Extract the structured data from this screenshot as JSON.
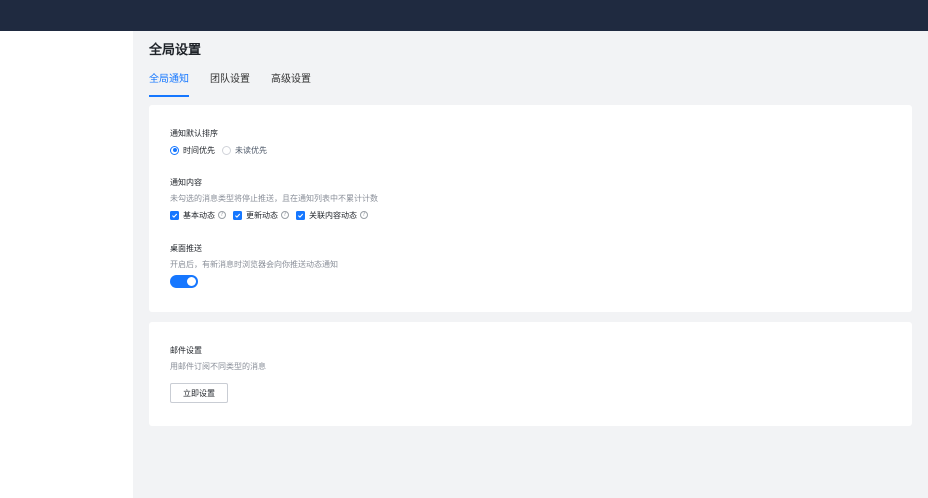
{
  "page": {
    "title": "全局设置"
  },
  "tabs": [
    {
      "label": "全局通知",
      "active": true
    },
    {
      "label": "团队设置",
      "active": false
    },
    {
      "label": "高级设置",
      "active": false
    }
  ],
  "notification_order": {
    "label": "通知默认排序",
    "options": [
      {
        "label": "时间优先",
        "selected": true
      },
      {
        "label": "未读优先",
        "selected": false
      }
    ]
  },
  "notification_content": {
    "label": "通知内容",
    "description": "未勾选的消息类型将停止推送，且在通知列表中不累计计数",
    "options": [
      {
        "label": "基本动态",
        "checked": true,
        "help_icon": "question-circle-icon"
      },
      {
        "label": "更新动态",
        "checked": true,
        "help_icon": "question-circle-icon"
      },
      {
        "label": "关联内容动态",
        "checked": true,
        "help_icon": "question-circle-icon"
      }
    ]
  },
  "desktop_push": {
    "label": "桌面推送",
    "description": "开启后，有新消息时浏览器会向你推送动态通知",
    "enabled": true
  },
  "email": {
    "label": "邮件设置",
    "description": "用邮件订阅不同类型的消息",
    "button_label": "立即设置"
  },
  "colors": {
    "topbar": "#1f2a40",
    "accent": "#1677ff",
    "background": "#f2f3f5"
  }
}
